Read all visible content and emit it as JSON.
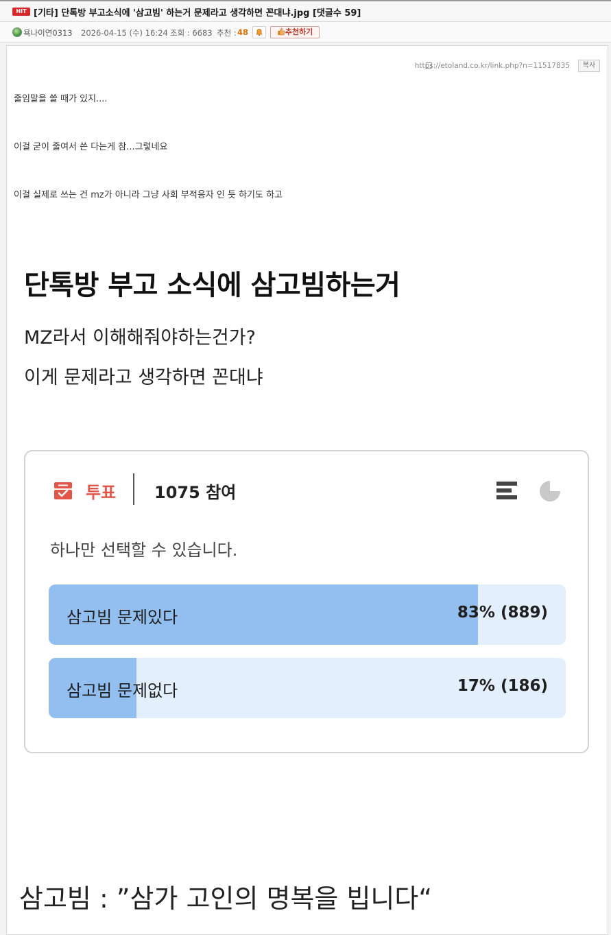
{
  "post": {
    "badge": "HIT",
    "title": "[기타] 단톡방 부고소식에 '삼고빔' 하는거 문제라고 생각하면 꼰대냐.jpg [댓글수 59]",
    "author": "욕나이연0313",
    "date": "2026-04-15 (수) 16:24",
    "views": "조회 : 6683",
    "recommend_label": "추천 :",
    "recommend_count": "48",
    "recommend_button": "추천하기"
  },
  "link": {
    "url": "https://etoland.co.kr/link.php?n=11517835",
    "copy_label": "복사"
  },
  "body": {
    "line1": "줄임말을 쓸 때가 있지....",
    "line2": "이걸 굳이 줄여서 쓴 다는게 참...그렇네요",
    "line3": "이걸 실제로 쓰는 건 mz가 아니라 그냥 사회 부적응자 인 듯 하기도 하고"
  },
  "image": {
    "title": "단톡방 부고 소식에 삼고빔하는거",
    "subtitle1": "MZ라서 이해해줘야하는건가?",
    "subtitle2": "이게 문제라고 생각하면 꼰대냐",
    "caption": "삼고빔 : ”삼가 고인의 명복을 빕니다“"
  },
  "poll": {
    "label": "투표",
    "participants": "1075 참여",
    "instruction": "하나만 선택할 수 있습니다.",
    "options": [
      {
        "label": "삼고빔 문제있다",
        "result": "83% (889)",
        "percent": 83
      },
      {
        "label": "삼고빔 문제없다",
        "result": "17% (186)",
        "percent": 17
      }
    ]
  },
  "colors": {
    "poll_red": "#e2564a",
    "bar_fill": "#92bff0",
    "bar_track": "#e3effc",
    "hit_badge": "#d62a2a",
    "recommend_count": "#e07000"
  },
  "icons": [
    "globe-icon",
    "bell-icon",
    "thumbs-up-icon",
    "link-icon",
    "ballot-box-icon",
    "bar-list-icon",
    "pie-chart-icon"
  ]
}
